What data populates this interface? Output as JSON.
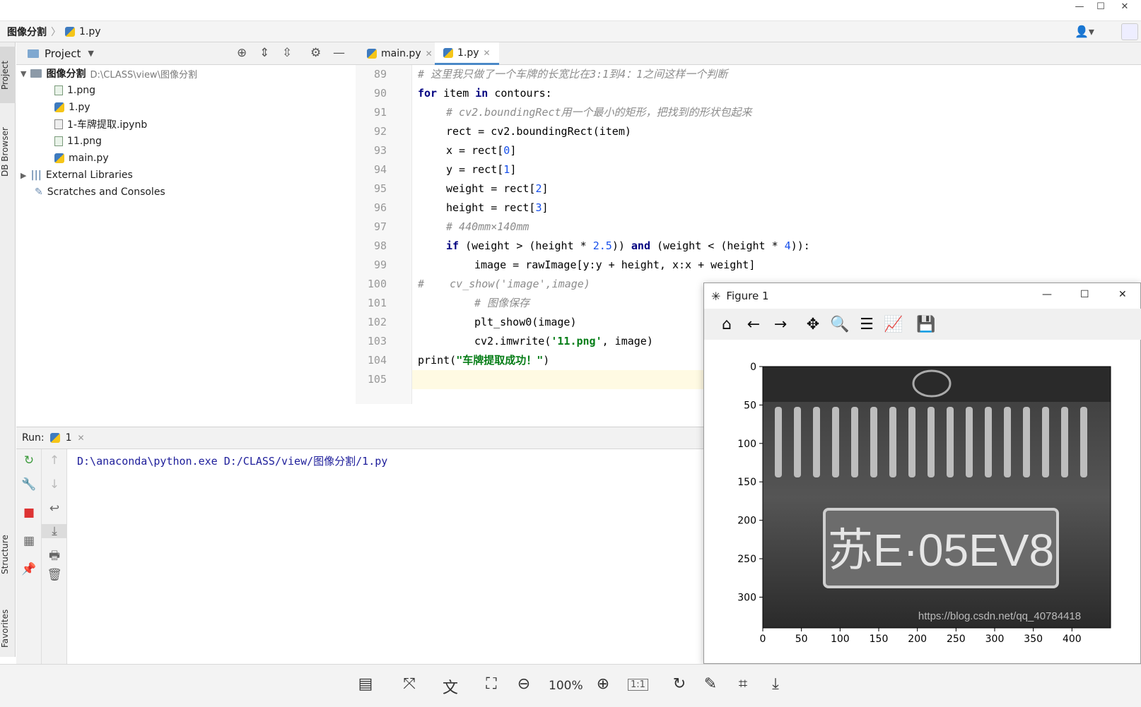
{
  "titlebar": {
    "minimize": "—",
    "maximize": "☐",
    "close": "✕"
  },
  "navbar": {
    "project": "图像分割",
    "file": "1.py",
    "user_icon": "user-icon"
  },
  "left_tool_tabs": [
    "Project",
    "DB Browser",
    "Structure",
    "Favorites"
  ],
  "project_panel": {
    "title": "Project",
    "tree": [
      {
        "label": "图像分割",
        "path": "D:\\CLASS\\view\\图像分割",
        "kind": "folder"
      },
      {
        "label": "1.png",
        "kind": "image"
      },
      {
        "label": "1.py",
        "kind": "python"
      },
      {
        "label": "1-车牌提取.ipynb",
        "kind": "notebook"
      },
      {
        "label": "11.png",
        "kind": "image"
      },
      {
        "label": "main.py",
        "kind": "python"
      },
      {
        "label": "External Libraries",
        "kind": "library"
      },
      {
        "label": "Scratches and Consoles",
        "kind": "scratch"
      }
    ]
  },
  "editor": {
    "tabs": [
      {
        "label": "main.py",
        "active": false
      },
      {
        "label": "1.py",
        "active": true
      }
    ],
    "line_numbers": [
      "89",
      "90",
      "91",
      "92",
      "93",
      "94",
      "95",
      "96",
      "97",
      "98",
      "99",
      "100",
      "101",
      "102",
      "103",
      "104",
      "105"
    ],
    "lines": {
      "l89": "# 这里我只做了一个车牌的长宽比在3:1到4：1之间这样一个判断",
      "l90_kw": "for",
      "l90_a": " item ",
      "l90_kw2": "in",
      "l90_b": " contours:",
      "l91": "# cv2.boundingRect用一个最小的矩形，把找到的形状包起来",
      "l92": "rect = cv2.boundingRect(item)",
      "l93_a": "x = rect[",
      "l93_n": "0",
      "l93_b": "]",
      "l94_a": "y = rect[",
      "l94_n": "1",
      "l94_b": "]",
      "l95_a": "weight = rect[",
      "l95_n": "2",
      "l95_b": "]",
      "l96_a": "height = rect[",
      "l96_n": "3",
      "l96_b": "]",
      "l97": "# 440mm×140mm",
      "l98_kw": "if",
      "l98_a": " (weight > (height * ",
      "l98_n1": "2.5",
      "l98_b": ")) ",
      "l98_kw2": "and",
      "l98_c": " (weight < (height * ",
      "l98_n2": "4",
      "l98_d": ")):",
      "l99": "image = rawImage[y:y + height, x:x + weight]",
      "l100": "#    cv_show('image',image)",
      "l101": "# 图像保存",
      "l102": "plt_show0(image)",
      "l103_a": "cv2.imwrite(",
      "l103_s": "'11.png'",
      "l103_b": ", image)",
      "l104_a": "print(",
      "l104_s": "\"车牌提取成功！\"",
      "l104_b": ")"
    }
  },
  "run": {
    "label": "Run:",
    "config": "1",
    "command": "D:\\anaconda\\python.exe D:/CLASS/view/图像分割/1.py"
  },
  "figure": {
    "title": "Figure 1",
    "tools": [
      "home-icon",
      "back-icon",
      "forward-icon",
      "pan-icon",
      "zoom-icon",
      "configure-icon",
      "edit-axes-icon",
      "save-icon"
    ],
    "image": {
      "plate_text": "苏E·05EV8",
      "watermark": "https://blog.csdn.net/qq_40784418"
    }
  },
  "chart_data": {
    "type": "image",
    "xticks": [
      "0",
      "50",
      "100",
      "150",
      "200",
      "250",
      "300",
      "350",
      "400"
    ],
    "yticks": [
      "0",
      "50",
      "100",
      "150",
      "200",
      "250",
      "300"
    ],
    "xlim": [
      0,
      450
    ],
    "ylim": [
      0,
      340
    ]
  },
  "viewer_bar": {
    "zoom": "100%",
    "ratio": "1:1"
  }
}
